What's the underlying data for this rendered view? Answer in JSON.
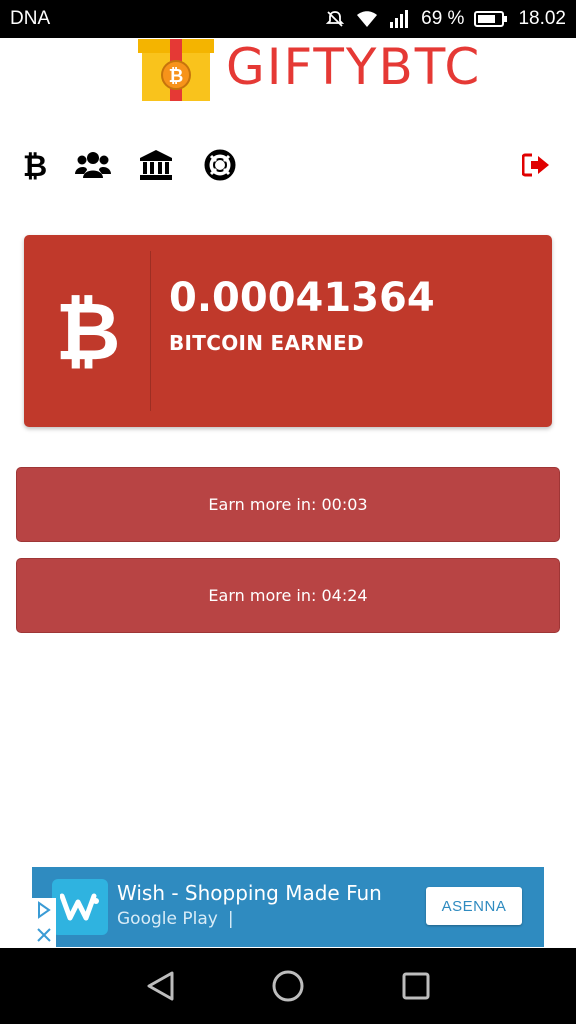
{
  "status_bar": {
    "carrier": "DNA",
    "battery_percent": "69 %",
    "time": "18.02",
    "icons": [
      "mute-icon",
      "wifi-icon",
      "signal-icon",
      "battery-icon"
    ]
  },
  "header": {
    "logo_text": "GIFTYBTC"
  },
  "nav": {
    "items": [
      {
        "icon": "bitcoin-icon"
      },
      {
        "icon": "users-icon"
      },
      {
        "icon": "bank-icon"
      },
      {
        "icon": "support-icon"
      },
      {
        "icon": "logout-icon"
      }
    ]
  },
  "balance": {
    "amount": "0.00041364",
    "label": "BITCOIN EARNED",
    "color": "#c0392b"
  },
  "timers": [
    {
      "label": "Earn more in: 00:03"
    },
    {
      "label": "Earn more in: 04:24"
    }
  ],
  "ad": {
    "title": "Wish - Shopping Made Fun",
    "store": "Google Play",
    "cta": "ASENNA",
    "color": "#2f8bc0"
  },
  "system_nav": {
    "icons": [
      "back-icon",
      "home-icon",
      "recents-icon"
    ]
  }
}
